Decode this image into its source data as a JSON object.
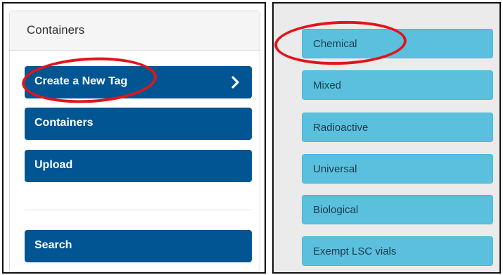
{
  "left_panel": {
    "header": "Containers",
    "buttons": [
      {
        "label": "Create a New Tag"
      },
      {
        "label": "Containers"
      },
      {
        "label": "Upload"
      },
      {
        "label": "Search"
      }
    ]
  },
  "right_panel": {
    "tag_types": [
      {
        "label": "Chemical"
      },
      {
        "label": "Mixed"
      },
      {
        "label": "Radioactive"
      },
      {
        "label": "Universal"
      },
      {
        "label": "Biological"
      },
      {
        "label": "Exempt LSC vials"
      }
    ]
  },
  "colors": {
    "primary_button": "#005592",
    "tag_button": "#5bc0de",
    "annotation": "#e2141a"
  },
  "icons": {
    "create_tag_arrow": "chevron-right-icon"
  }
}
